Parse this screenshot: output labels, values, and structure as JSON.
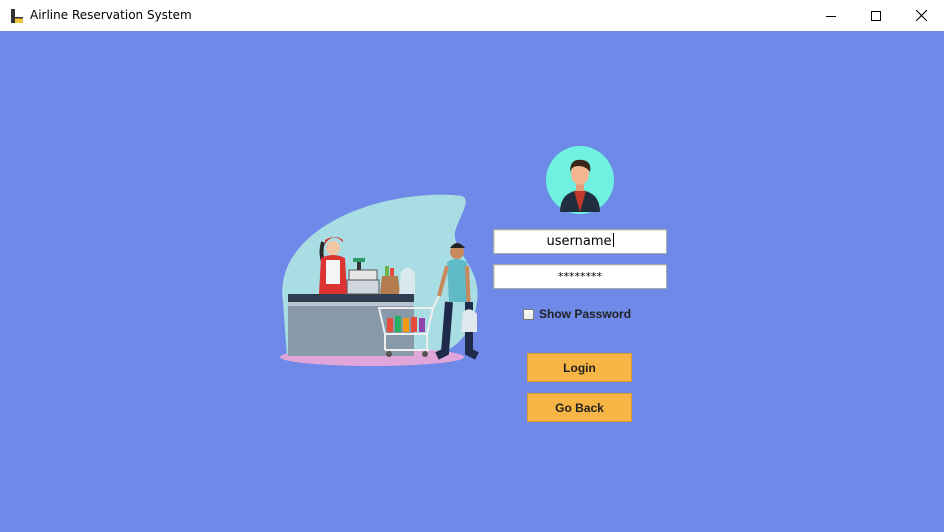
{
  "window": {
    "title": "Airline Reservation System",
    "controls": {
      "minimize": "minimize-icon",
      "maximize": "maximize-icon",
      "close": "close-icon"
    }
  },
  "colors": {
    "background": "#6e89e8",
    "button": "#f6b544",
    "avatar_bg": "#6ff0e0"
  },
  "login_form": {
    "username_value": "username",
    "password_value": "********",
    "show_password_label": "Show Password",
    "show_password_checked": false,
    "login_label": "Login",
    "go_back_label": "Go Back"
  },
  "images": {
    "illustration": "grocery-checkout-illustration",
    "avatar": "user-avatar-icon"
  }
}
